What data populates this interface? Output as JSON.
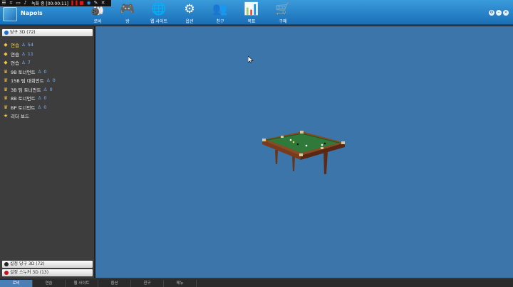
{
  "recorder": {
    "status": "녹화 중 [00:00:11]"
  },
  "app": {
    "name": "Napols"
  },
  "nav": [
    {
      "label": "로비",
      "icon": "lobby-icon",
      "glyph": "🎳"
    },
    {
      "label": "방",
      "icon": "room-icon",
      "glyph": "🎮"
    },
    {
      "label": "웹 사이트",
      "icon": "website-icon",
      "glyph": "🌐"
    },
    {
      "label": "옵션",
      "icon": "options-icon",
      "glyph": "⚙"
    },
    {
      "label": "친구",
      "icon": "friends-icon",
      "glyph": "👥"
    },
    {
      "label": "목표",
      "icon": "goals-icon",
      "glyph": "📊"
    },
    {
      "label": "구매",
      "icon": "purchase-icon",
      "glyph": "🛒"
    }
  ],
  "sidebar": {
    "header": "당구 3D (72)",
    "items": [
      {
        "label": "연습",
        "count": "54",
        "type": "practice",
        "active": true
      },
      {
        "label": "연습",
        "count": "11",
        "type": "practice",
        "active": false
      },
      {
        "label": "연습",
        "count": "7",
        "type": "practice",
        "active": false
      },
      {
        "label": "9B 토너먼트",
        "count": "0",
        "type": "trophy",
        "active": false
      },
      {
        "label": "15B 팀 대회언트",
        "count": "0",
        "type": "trophy",
        "active": false
      },
      {
        "label": "3B 팀 토너먼트",
        "count": "0",
        "type": "trophy",
        "active": false
      },
      {
        "label": "8B 토너먼트",
        "count": "0",
        "type": "trophy",
        "active": false
      },
      {
        "label": "BP 토너먼트",
        "count": "0",
        "type": "trophy",
        "active": false
      },
      {
        "label": "리더 보드",
        "count": "",
        "type": "star",
        "active": false
      }
    ],
    "games": [
      {
        "label": "설정 당구 3D (72)"
      },
      {
        "label": "설정 스누커 3D (13)"
      }
    ]
  },
  "bottom_tabs": [
    "로비",
    "연습",
    "웹 사이트",
    "옵션",
    "친구",
    "메뉴"
  ],
  "colors": {
    "header": "#1a6fb7",
    "main_bg": "#3b75a9",
    "sidebar_bg": "#3d3d3d",
    "felt": "#2f7a3a",
    "wood": "#7a3b1c"
  }
}
